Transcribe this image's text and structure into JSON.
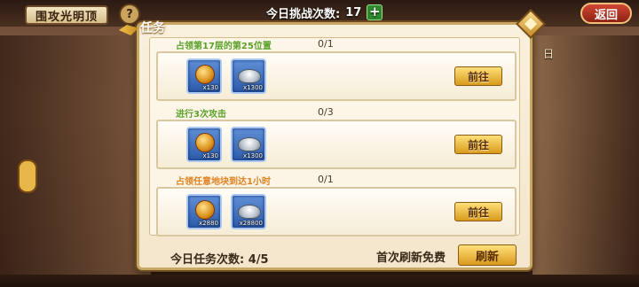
{
  "top": {
    "title": "围攻光明顶",
    "help_icon": "help-icon",
    "challenge_label": "今日挑战次数:",
    "challenge_count": "17",
    "plus_label": "+",
    "back_label": "返回"
  },
  "side": {
    "right_text": "日"
  },
  "panel": {
    "title": "任务",
    "tasks": [
      {
        "label": "占领第17层的第25位置",
        "label_color": "#5aa12a",
        "progress": "0/1",
        "rewards": [
          {
            "icon": "gold-gem-icon",
            "qty": "x130"
          },
          {
            "icon": "silver-ingot-icon",
            "qty": "x1300"
          }
        ],
        "button": "前往"
      },
      {
        "label": "进行3次攻击",
        "label_color": "#5aa12a",
        "progress": "0/3",
        "rewards": [
          {
            "icon": "gold-gem-icon",
            "qty": "x130"
          },
          {
            "icon": "silver-ingot-icon",
            "qty": "x1300"
          }
        ],
        "button": "前往"
      },
      {
        "label": "占领任意地块到达1小时",
        "label_color": "#e0801e",
        "progress": "0/1",
        "rewards": [
          {
            "icon": "gold-gem-icon",
            "qty": "x2880"
          },
          {
            "icon": "silver-ingot-icon",
            "qty": "x28800"
          }
        ],
        "button": "前往"
      }
    ],
    "footer": {
      "tasks_label": "今日任务次数:",
      "tasks_count": "4/5",
      "free_refresh": "首次刷新免费",
      "refresh_button": "刷新"
    }
  }
}
